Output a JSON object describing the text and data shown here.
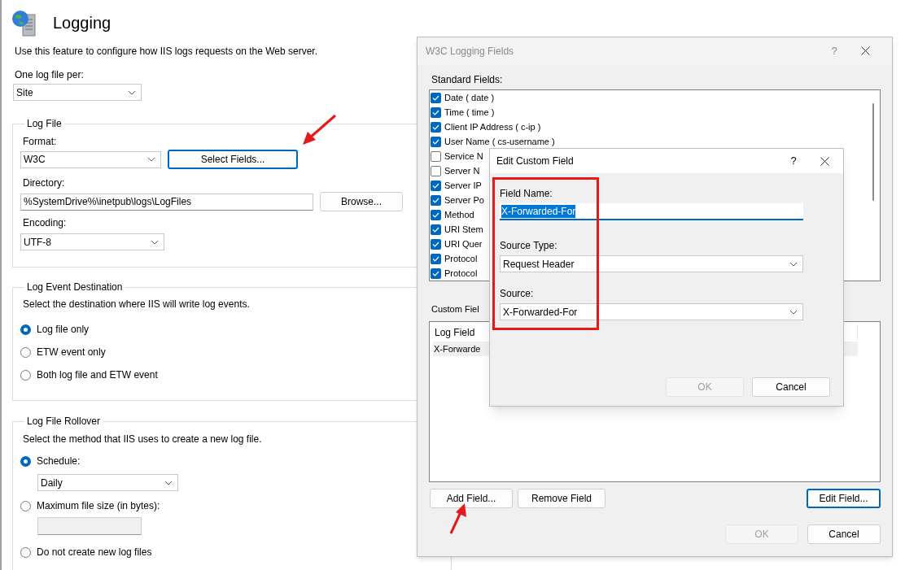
{
  "page": {
    "title": "Logging",
    "description": "Use this feature to configure how IIS logs requests on the Web server.",
    "log_file_per": {
      "label": "One log file per:",
      "value": "Site"
    },
    "log_file": {
      "legend": "Log File",
      "format": {
        "label": "Format:",
        "value": "W3C"
      },
      "select_fields_button": {
        "label": "Select Fields...",
        "focused": true
      },
      "directory": {
        "label": "Directory:",
        "value": "%SystemDrive%\\inetpub\\logs\\LogFiles"
      },
      "browse_button": {
        "label": "Browse...",
        "focused": false
      },
      "encoding": {
        "label": "Encoding:",
        "value": "UTF-8"
      }
    },
    "log_event_destination": {
      "legend": "Log Event Destination",
      "description": "Select the destination where IIS will write log events.",
      "options": [
        {
          "label": "Log file only",
          "selected": true
        },
        {
          "label": "ETW event only",
          "selected": false
        },
        {
          "label": "Both log file and ETW event",
          "selected": false
        }
      ]
    },
    "log_file_rollover": {
      "legend": "Log File Rollover",
      "description": "Select the method that IIS uses to create a new log file.",
      "options": [
        {
          "kind": "select",
          "label": "Schedule:",
          "selected": true,
          "value": "Daily"
        },
        {
          "kind": "input",
          "label": "Maximum file size (in bytes):",
          "selected": false
        },
        {
          "kind": "plain",
          "label": "Do not create new log files",
          "selected": false
        }
      ]
    }
  },
  "w3c_dialog": {
    "title": "W3C Logging Fields",
    "active": false,
    "help": "?",
    "standard_fields": {
      "label": "Standard Fields:",
      "items": [
        {
          "label": "Date ( date )",
          "checked": true
        },
        {
          "label": "Time ( time )",
          "checked": true
        },
        {
          "label": "Client IP Address ( c-ip )",
          "checked": true
        },
        {
          "label": "User Name ( cs-username )",
          "checked": true
        },
        {
          "label": "Service N",
          "checked": false
        },
        {
          "label": "Server N",
          "checked": false
        },
        {
          "label": "Server IP",
          "checked": true
        },
        {
          "label": "Server Po",
          "checked": true
        },
        {
          "label": "Method",
          "checked": true
        },
        {
          "label": "URI Stem",
          "checked": true
        },
        {
          "label": "URI Quer",
          "checked": true
        },
        {
          "label": "Protocol",
          "checked": true
        },
        {
          "label": "Protocol",
          "checked": true
        }
      ]
    },
    "custom_fields": {
      "label": "Custom Fiel",
      "columns": [
        "Log Field"
      ],
      "rows": [
        {
          "cells": [
            "X-Forwarde"
          ],
          "selected": true
        }
      ]
    },
    "list_buttons": [
      {
        "label": "Add Field...",
        "focused": false
      },
      {
        "label": "Remove Field",
        "focused": false
      },
      {
        "label": "Edit Field...",
        "focused": true
      }
    ],
    "footer_buttons": [
      {
        "label": "OK",
        "disabled": true
      },
      {
        "label": "Cancel",
        "disabled": false
      }
    ]
  },
  "edit_dialog": {
    "title": "Edit Custom Field",
    "active": true,
    "help": "?",
    "field_name": {
      "label": "Field Name:",
      "value": "X-Forwarded-For",
      "text_selected": true
    },
    "source_type": {
      "label": "Source Type:",
      "value": "Request Header"
    },
    "source": {
      "label": "Source:",
      "value": "X-Forwarded-For"
    },
    "buttons": [
      {
        "label": "OK",
        "disabled": true
      },
      {
        "label": "Cancel",
        "disabled": false
      }
    ]
  }
}
